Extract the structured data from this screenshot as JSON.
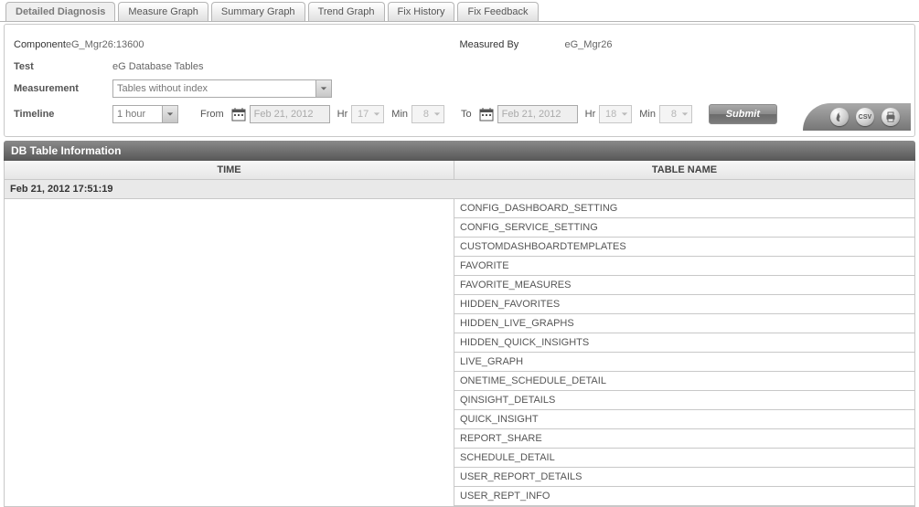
{
  "tabs": [
    {
      "label": "Detailed Diagnosis",
      "active": true
    },
    {
      "label": "Measure Graph"
    },
    {
      "label": "Summary Graph"
    },
    {
      "label": "Trend Graph"
    },
    {
      "label": "Fix History"
    },
    {
      "label": "Fix Feedback"
    }
  ],
  "filter": {
    "component_label": "Component",
    "component_value": "eG_Mgr26:13600",
    "measured_by_label": "Measured By",
    "measured_by_value": "eG_Mgr26",
    "test_label": "Test",
    "test_value": "eG Database Tables",
    "measurement_label": "Measurement",
    "measurement_value": "Tables without index",
    "timeline_label": "Timeline",
    "timeline_value": "1 hour",
    "from_label": "From",
    "from_date": "Feb 21, 2012",
    "from_hr_label": "Hr",
    "from_hr": "17",
    "from_min_label": "Min",
    "from_min": "8",
    "to_label": "To",
    "to_date": "Feb 21, 2012",
    "to_hr_label": "Hr",
    "to_hr": "18",
    "to_min_label": "Min",
    "to_min": "8",
    "submit_label": "Submit"
  },
  "actions": {
    "csv": "CSV"
  },
  "section_title": "DB Table Information",
  "table": {
    "col_time": "TIME",
    "col_name": "TABLE NAME",
    "group_time": "Feb 21, 2012 17:51:19",
    "rows": [
      "CONFIG_DASHBOARD_SETTING",
      "CONFIG_SERVICE_SETTING",
      "CUSTOMDASHBOARDTEMPLATES",
      "FAVORITE",
      "FAVORITE_MEASURES",
      "HIDDEN_FAVORITES",
      "HIDDEN_LIVE_GRAPHS",
      "HIDDEN_QUICK_INSIGHTS",
      "LIVE_GRAPH",
      "ONETIME_SCHEDULE_DETAIL",
      "QINSIGHT_DETAILS",
      "QUICK_INSIGHT",
      "REPORT_SHARE",
      "SCHEDULE_DETAIL",
      "USER_REPORT_DETAILS",
      "USER_REPT_INFO"
    ]
  }
}
